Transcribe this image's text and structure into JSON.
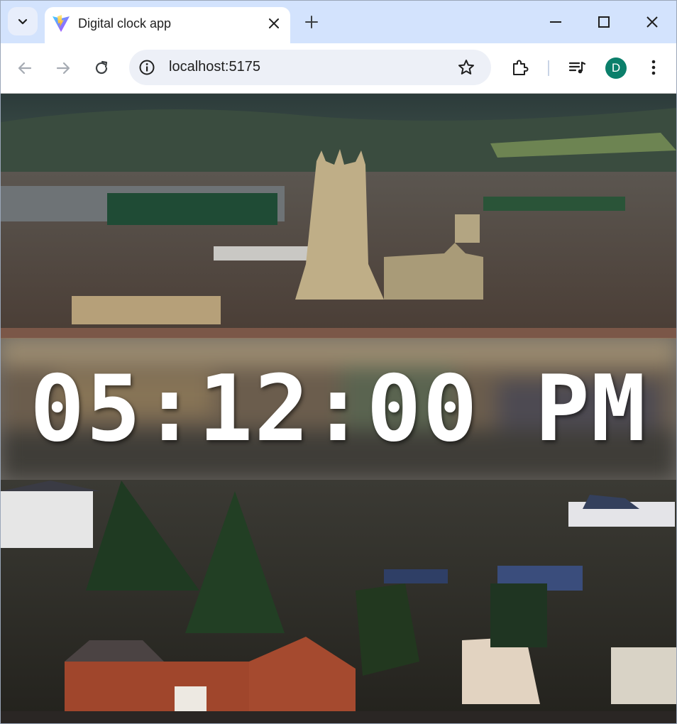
{
  "browser": {
    "tab_title": "Digital clock app",
    "url": "localhost:5175",
    "profile_initial": "D",
    "accent_color": "#0b7f6b"
  },
  "icons": [
    "tab-search-icon",
    "vite-favicon-icon",
    "close-icon",
    "plus-icon",
    "minimize-icon",
    "maximize-icon",
    "window-close-icon",
    "back-arrow-icon",
    "forward-arrow-icon",
    "reload-icon",
    "site-info-icon",
    "bookmark-star-icon",
    "extensions-icon",
    "media-control-icon",
    "more-menu-icon"
  ],
  "clock": {
    "time": "05:12:00 PM",
    "text_color": "#ffffff"
  }
}
